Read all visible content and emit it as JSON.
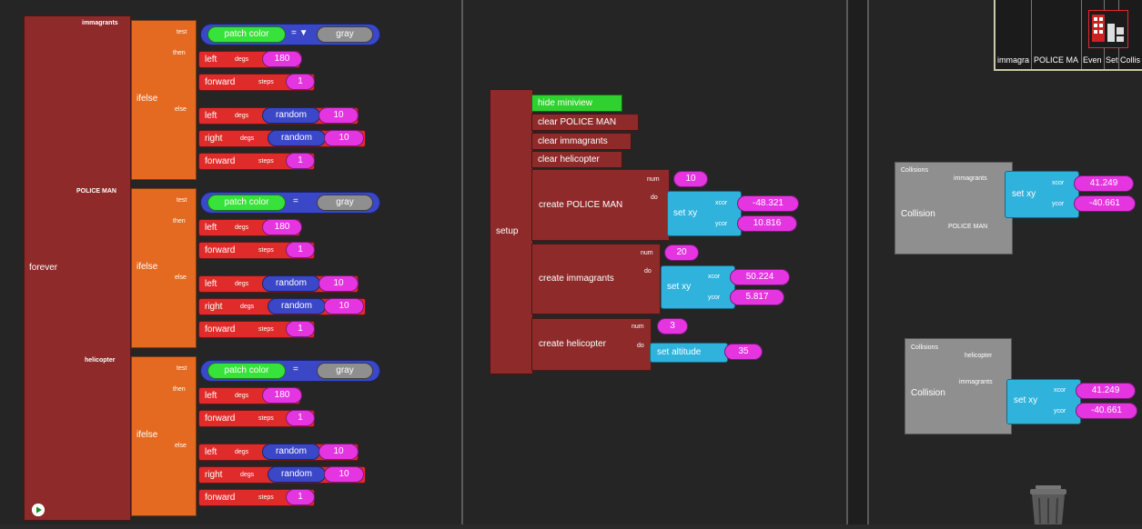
{
  "colors": {
    "background": "#252525",
    "forever_block": "#8e2a2a",
    "ifelse_block": "#e46a22",
    "command_block": "#e02b2b",
    "number_pill": "#e535e0",
    "reporter_pill": "#3a47c7",
    "agent_reporter": "#37e23b",
    "gray_pill": "#8f8f8f",
    "setxy_block": "#2fb3dc",
    "collision_block": "#8f8f8f"
  },
  "forever_block": {
    "label": "forever",
    "sections": [
      {
        "agent": "immagrants",
        "ifelse_label": "ifelse",
        "test_label": "test",
        "then_label": "then",
        "else_label": "else",
        "condition": {
          "left": "patch color",
          "op": "= ▼",
          "right": "gray"
        },
        "then_cmds": [
          {
            "name": "left",
            "param": "degs",
            "value": "180"
          },
          {
            "name": "forward",
            "param": "steps",
            "value": "1"
          }
        ],
        "else_cmds": [
          {
            "name": "left",
            "param": "degs",
            "reporter": "random",
            "value": "10"
          },
          {
            "name": "right",
            "param": "degs",
            "reporter": "random",
            "value": "10"
          },
          {
            "name": "forward",
            "param": "steps",
            "value": "1"
          }
        ]
      },
      {
        "agent": "POLICE MAN",
        "ifelse_label": "ifelse",
        "test_label": "test",
        "then_label": "then",
        "else_label": "else",
        "condition": {
          "left": "patch color",
          "op": "=",
          "right": "gray"
        },
        "then_cmds": [
          {
            "name": "left",
            "param": "degs",
            "value": "180"
          },
          {
            "name": "forward",
            "param": "steps",
            "value": "1"
          }
        ],
        "else_cmds": [
          {
            "name": "left",
            "param": "degs",
            "reporter": "random",
            "value": "10"
          },
          {
            "name": "right",
            "param": "degs",
            "reporter": "random",
            "value": "10"
          },
          {
            "name": "forward",
            "param": "steps",
            "value": "1"
          }
        ]
      },
      {
        "agent": "helicopter",
        "ifelse_label": "ifelse",
        "test_label": "test",
        "then_label": "then",
        "else_label": "else",
        "condition": {
          "left": "patch color",
          "op": "=",
          "right": "gray"
        },
        "then_cmds": [
          {
            "name": "left",
            "param": "degs",
            "value": "180"
          },
          {
            "name": "forward",
            "param": "steps",
            "value": "1"
          }
        ],
        "else_cmds": [
          {
            "name": "left",
            "param": "degs",
            "reporter": "random",
            "value": "10"
          },
          {
            "name": "right",
            "param": "degs",
            "reporter": "random",
            "value": "10"
          },
          {
            "name": "forward",
            "param": "steps",
            "value": "1"
          }
        ]
      }
    ]
  },
  "setup_block": {
    "label": "setup",
    "hide_miniview": "hide miniview",
    "clear_police": "clear POLICE MAN",
    "clear_immagrants": "clear immagrants",
    "clear_helicopter": "clear helicopter",
    "create_police": {
      "label": "create POLICE MAN",
      "num_label": "num",
      "num": "10",
      "do_label": "do",
      "setxy": "set xy",
      "xcor_label": "xcor",
      "xcor": "-48.321",
      "ycor_label": "ycor",
      "ycor": "10.816"
    },
    "create_immagrants": {
      "label": "create immagrants",
      "num_label": "num",
      "num": "20",
      "do_label": "do",
      "setxy": "set xy",
      "xcor_label": "xcor",
      "xcor": "50.224",
      "ycor_label": "ycor",
      "ycor": "5.817"
    },
    "create_helicopter": {
      "label": "create helicopter",
      "num_label": "num",
      "num": "3",
      "do_label": "do",
      "set_altitude": "set altitude",
      "altitude": "35"
    }
  },
  "collisions": [
    {
      "header": "Collisions",
      "label": "Collision",
      "agent1": "immagrants",
      "agent2": "POLICE MAN",
      "setxy": "set xy",
      "xcor_label": "xcor",
      "xcor": "41.249",
      "ycor_label": "ycor",
      "ycor": "-40.661"
    },
    {
      "header": "Collisions",
      "label": "Collision",
      "agent1": "helicopter",
      "agent2": "immagrants",
      "setxy": "set xy",
      "xcor_label": "xcor",
      "xcor": "41.249",
      "ycor_label": "ycor",
      "ycor": "-40.661"
    }
  ],
  "tabs": [
    "immagra",
    "POLICE MA",
    "Even",
    "Set",
    "Collis"
  ],
  "icons": {
    "run": "play-icon",
    "trash": "trash-icon",
    "logo": "building-icon"
  }
}
